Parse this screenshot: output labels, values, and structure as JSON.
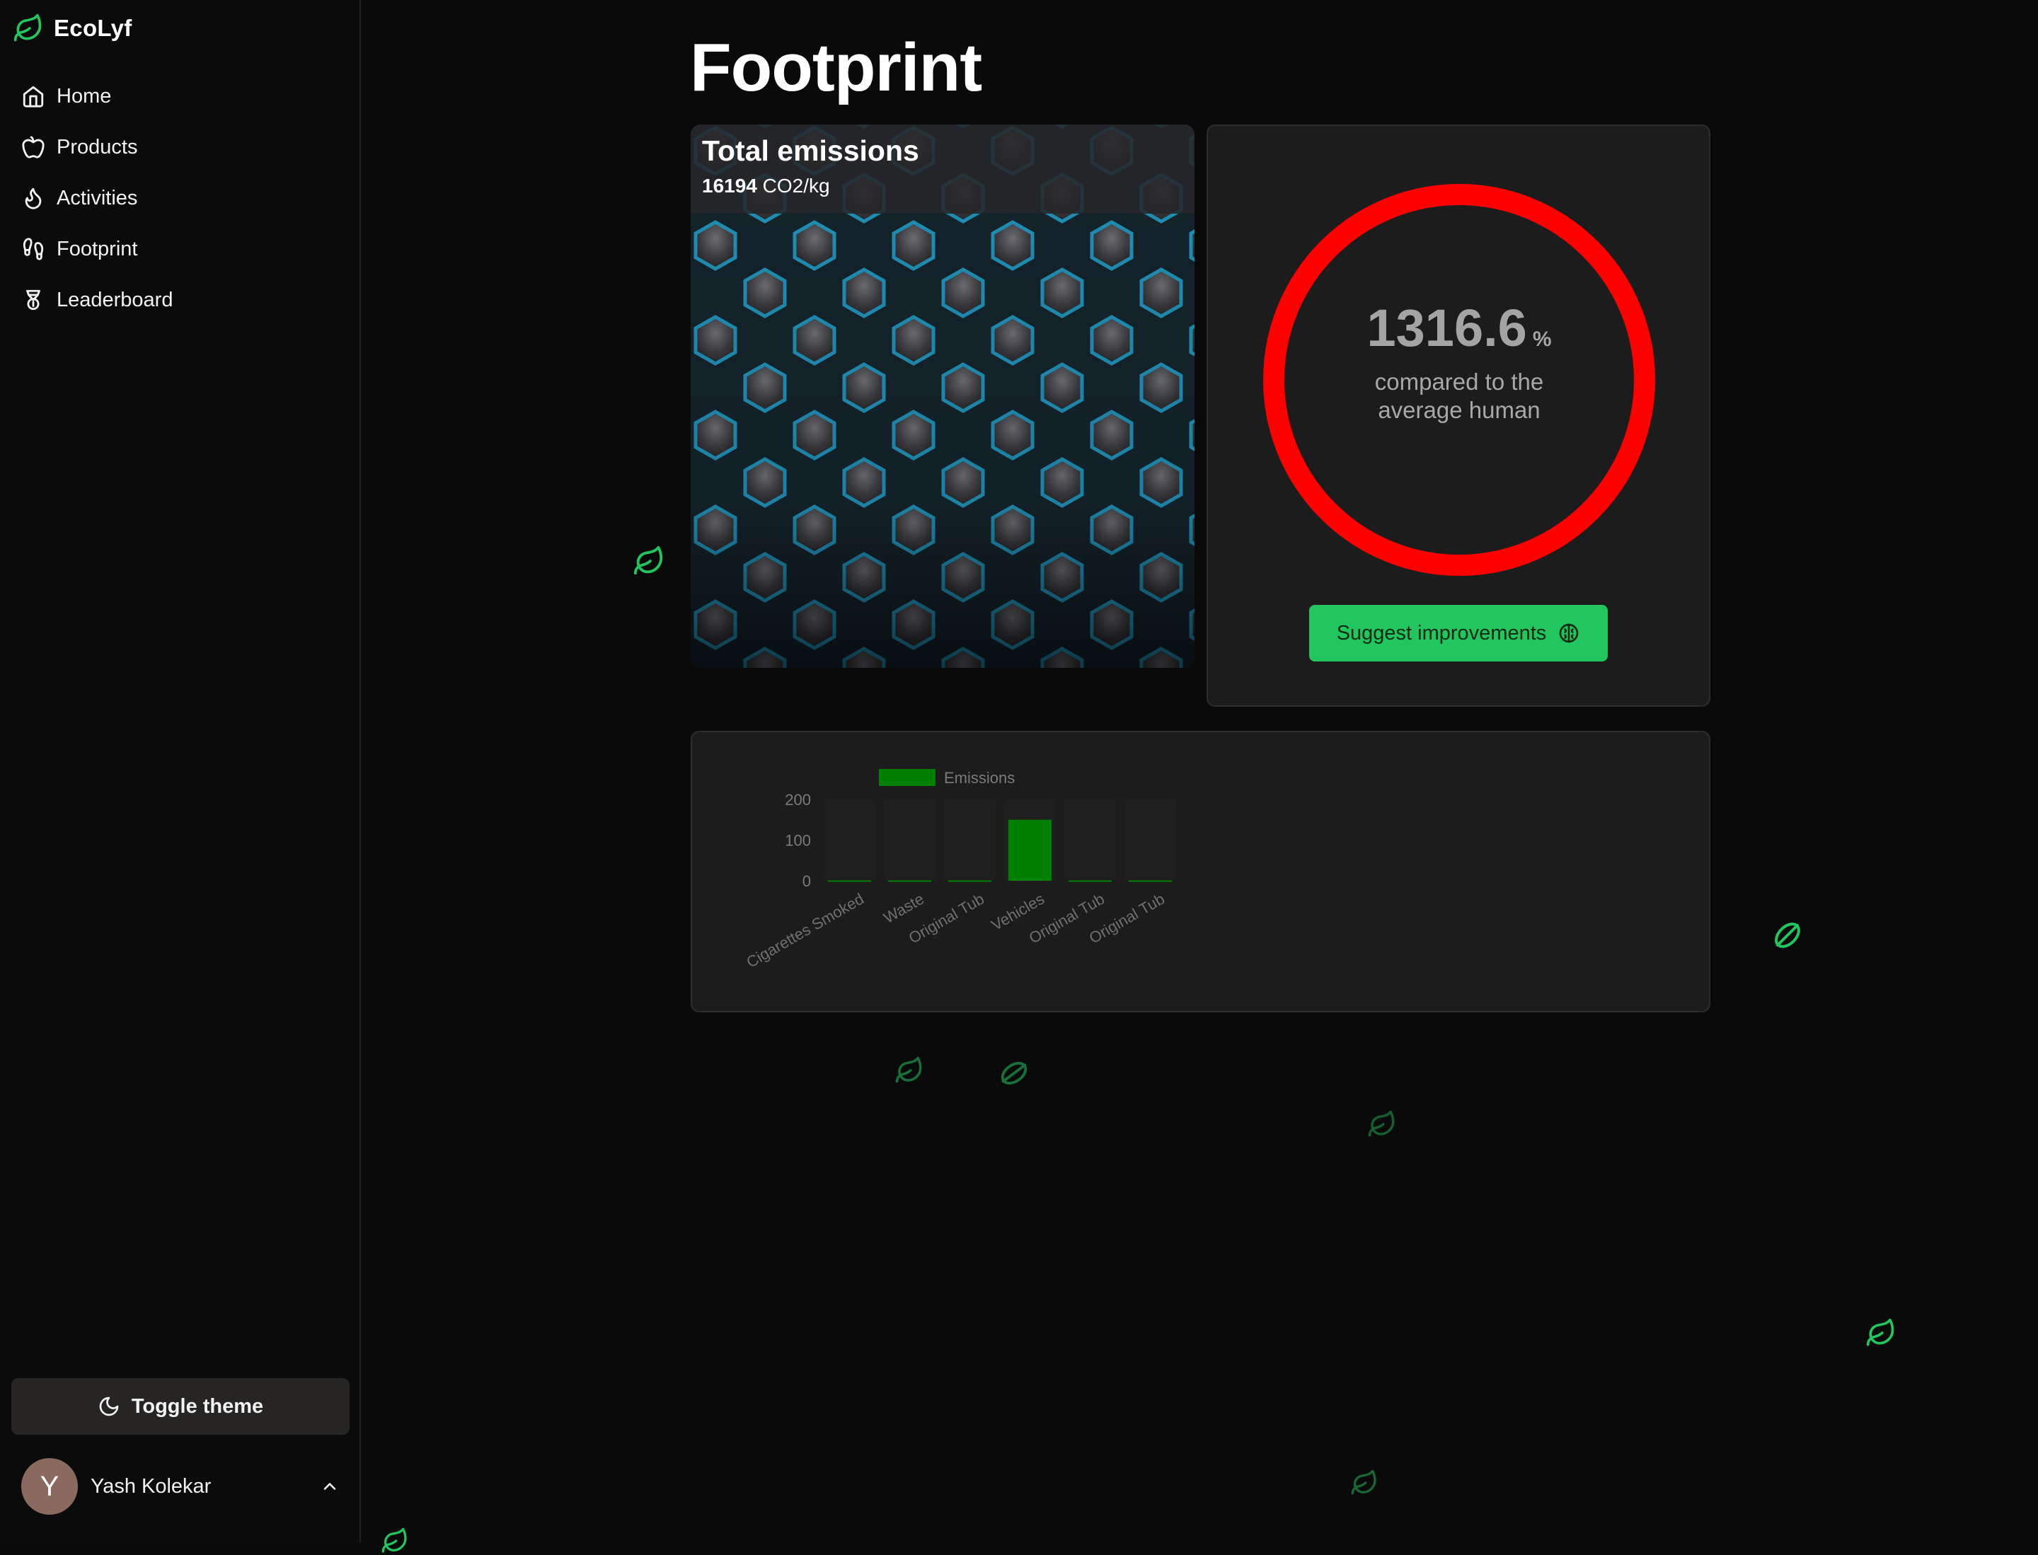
{
  "app": {
    "name": "EcoLyf"
  },
  "sidebar": {
    "items": [
      {
        "label": "Home"
      },
      {
        "label": "Products"
      },
      {
        "label": "Activities"
      },
      {
        "label": "Footprint"
      },
      {
        "label": "Leaderboard"
      }
    ],
    "toggle_theme_label": "Toggle theme",
    "user": {
      "initial": "Y",
      "name": "Yash Kolekar"
    }
  },
  "main": {
    "title": "Footprint",
    "total_emissions": {
      "title": "Total emissions",
      "value": "16194",
      "unit": "CO2/kg"
    },
    "comparison": {
      "percent": "1316.6",
      "unit": "%",
      "line1": "compared to the",
      "line2": "average human",
      "ring_color": "#ff0000"
    },
    "suggest_button_label": "Suggest improvements"
  },
  "colors": {
    "accent": "#22c55e",
    "bar": "#008000",
    "background": "#0a0a0a",
    "card": "#1c1c1c"
  },
  "chart_data": {
    "type": "bar",
    "categories": [
      "Cigarettes Smoked",
      "Waste",
      "Original Tub",
      "Vehicles",
      "Original Tub",
      "Original Tub"
    ],
    "series": [
      {
        "name": "Emissions",
        "values": [
          1,
          1,
          1,
          150,
          1,
          1
        ]
      }
    ],
    "yticks": [
      0,
      100,
      200
    ],
    "ylim": [
      0,
      200
    ],
    "legend": "top",
    "grid": false
  }
}
